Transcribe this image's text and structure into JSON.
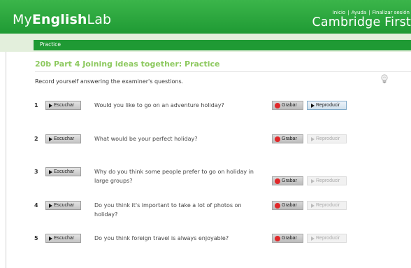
{
  "header": {
    "logo_prefix": "My",
    "logo_mid": "English",
    "logo_suffix": "Lab",
    "links": [
      "Inicio",
      "Ayuda",
      "Finalizar sesión"
    ],
    "separator": "|",
    "brand": "Cambridge First"
  },
  "tab": {
    "label": "Practice"
  },
  "page": {
    "title": "20b Part 4 Joining ideas together: Practice",
    "instruction": "Record yourself answering the examiner's questions.",
    "hint_icon": "lightbulb-icon"
  },
  "labels": {
    "listen": "Escuchar",
    "record": "Grabar",
    "play": "Reproducir"
  },
  "colors": {
    "header_green": "#1f9a34",
    "title_green": "#8dc95f",
    "record_red": "#e0282a"
  },
  "questions": [
    {
      "number": "1",
      "text": "Would you like to go on an adventure holiday?",
      "play_enabled": true
    },
    {
      "number": "2",
      "text": "What would be your perfect holiday?",
      "play_enabled": false
    },
    {
      "number": "3",
      "text": "Why do you think some people prefer to go on holiday in large groups?",
      "play_enabled": false
    },
    {
      "number": "4",
      "text": "Do you think it's important to take a lot of photos on holiday?",
      "play_enabled": false
    },
    {
      "number": "5",
      "text": "Do you think foreign travel is always enjoyable?",
      "play_enabled": false
    }
  ]
}
